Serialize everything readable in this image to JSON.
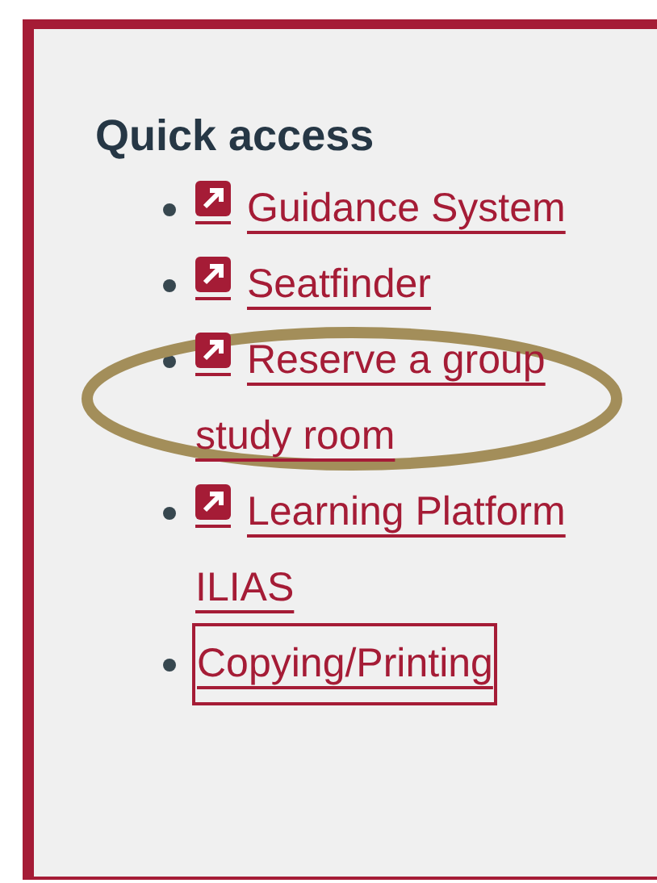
{
  "panel": {
    "heading": "Quick access",
    "items": [
      {
        "label": "Guidance System",
        "kind": "external",
        "highlighted": false,
        "focused": false
      },
      {
        "label": "Seatfinder",
        "kind": "external",
        "highlighted": false,
        "focused": false
      },
      {
        "label": "Reserve a group study room",
        "kind": "external",
        "highlighted": true,
        "focused": false
      },
      {
        "label": "Learning Platform ILIAS",
        "kind": "external",
        "highlighted": false,
        "focused": false
      },
      {
        "label": "Copying/Printing",
        "kind": "internal",
        "highlighted": false,
        "focused": true
      }
    ]
  }
}
